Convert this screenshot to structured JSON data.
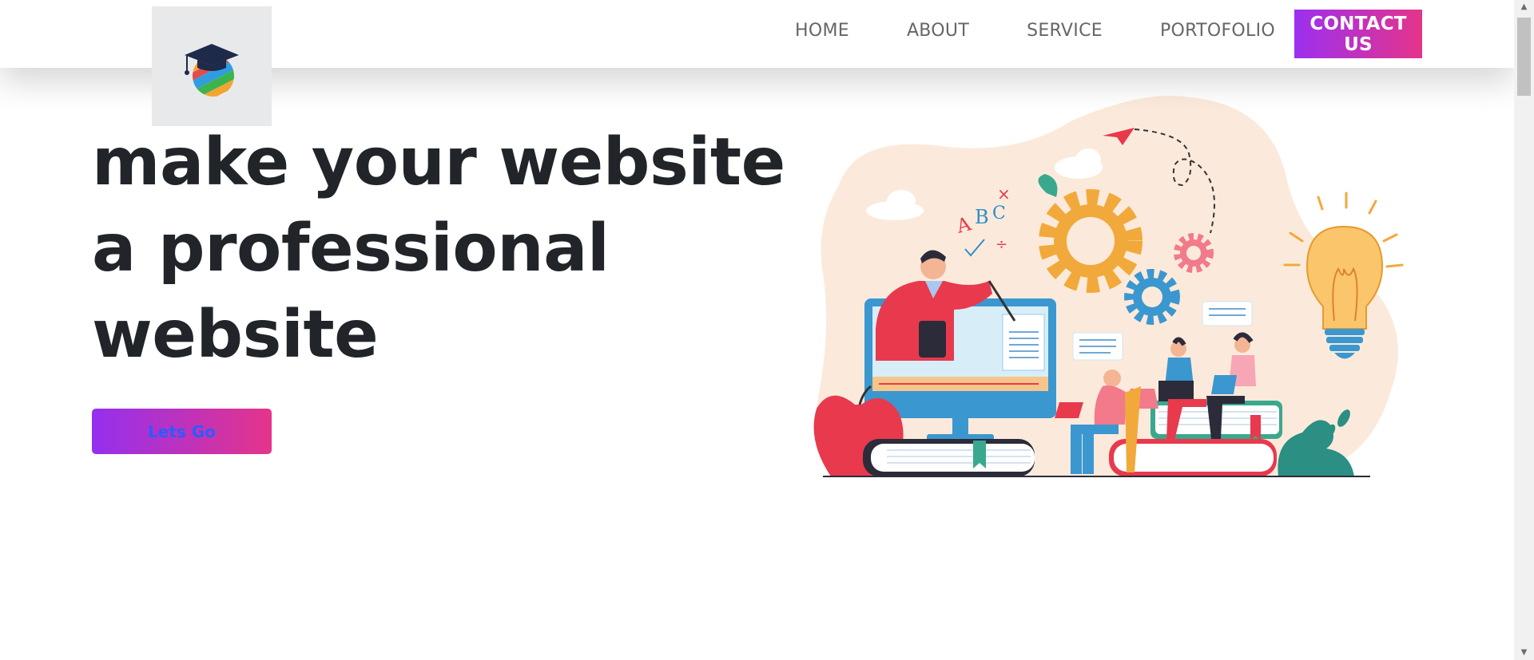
{
  "nav": {
    "logo_icon": "graduation-cap-globe-icon",
    "links": [
      "HOME",
      "ABOUT",
      "SERVICE",
      "PORTOFOLIO"
    ],
    "contact_label": "CONTACT US"
  },
  "hero": {
    "title_lines": [
      "make your website",
      "a professional",
      "website"
    ],
    "cta_label": "Lets Go",
    "illustration": "online-education-illustration"
  },
  "colors": {
    "gradient_start": "#9b30f0",
    "gradient_end": "#e5348a",
    "cta_text": "#2a5cff",
    "title": "#212529"
  }
}
